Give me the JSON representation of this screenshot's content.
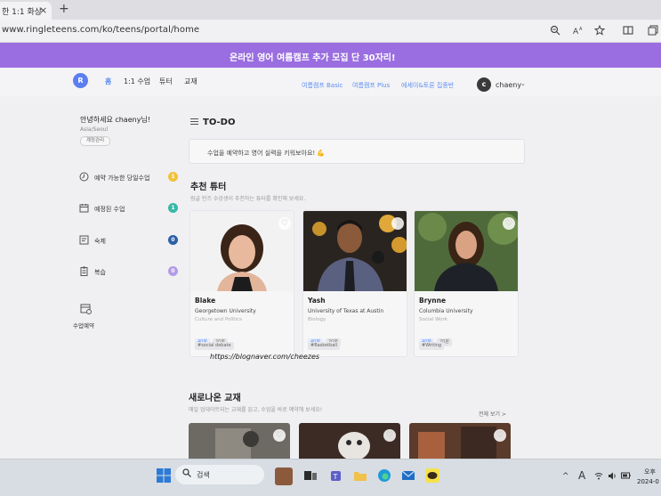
{
  "browser": {
    "tab_title": "한 1:1 화상",
    "tab_close": "×",
    "new_tab": "+",
    "url": "www.ringleteens.com/ko/teens/portal/home"
  },
  "banner": {
    "text": "온라인 영어 여름캠프 추가 모집 단 30자리!"
  },
  "nav": {
    "logo": "R",
    "home": "홈",
    "lesson": "1:1 수업",
    "tutor": "튜터",
    "material": "교재",
    "promo_1": "여름캠프 Basic",
    "promo_2": "여름캠프 Plus",
    "promo_3": "에세이&토론 집중반",
    "avatar_initial": "c",
    "username": "chaeny",
    "chevron": "⌄"
  },
  "sidebar": {
    "greeting": "안녕하세요 chaeny님!",
    "location": "Asia/Seoul",
    "manage": "계정관리",
    "items": [
      {
        "label": "예약 가능한 당일수업",
        "badge": "1",
        "icon": "clock-icon"
      },
      {
        "label": "예정된 수업",
        "badge": "1",
        "icon": "calendar-icon"
      },
      {
        "label": "숙제",
        "badge": "0",
        "icon": "homework-icon"
      },
      {
        "label": "복습",
        "badge": "0",
        "icon": "review-icon"
      }
    ],
    "book_label": "수업예약"
  },
  "todo": {
    "title": "TO-DO",
    "message": "수업을 예약하고 영어 실력을 키워보아요! 💪"
  },
  "tutors": {
    "title": "추천 튜터",
    "subtitle": "링글 틴즈 수강생이 추천하는 튜터를 확인해 보세요.",
    "cards": [
      {
        "name": "Blake",
        "university": "Georgetown University",
        "major": "Culture and Politics",
        "tag_1": "40분",
        "tag_2": "20분",
        "hashtag": "#social debate"
      },
      {
        "name": "Yash",
        "university": "University of Texas at Austin",
        "major": "Biology",
        "tag_1": "40분",
        "tag_2": "20분",
        "hashtag": "#Basketball"
      },
      {
        "name": "Brynne",
        "university": "Columbia University",
        "major": "Social Work",
        "tag_1": "40분",
        "tag_2": "20분",
        "hashtag": "#Writing"
      }
    ]
  },
  "watermark": "https://blognaver.com/cheezes",
  "materials": {
    "title": "새로나온 교재",
    "subtitle": "매일 업데이트되는 교재를 읽고, 수업을 바로 예약해 보세요!",
    "see_all": "전체 보기 >"
  },
  "taskbar": {
    "search_label": "검색",
    "clock_time": "오후",
    "clock_date": "2024-0"
  },
  "colors": {
    "banner": "#9a6ee0",
    "accent_blue": "#5e8df0",
    "badge_yellow": "#f2c23c",
    "badge_teal": "#39b8a8",
    "badge_navy": "#2d5ea8",
    "badge_purple": "#b39be8"
  }
}
